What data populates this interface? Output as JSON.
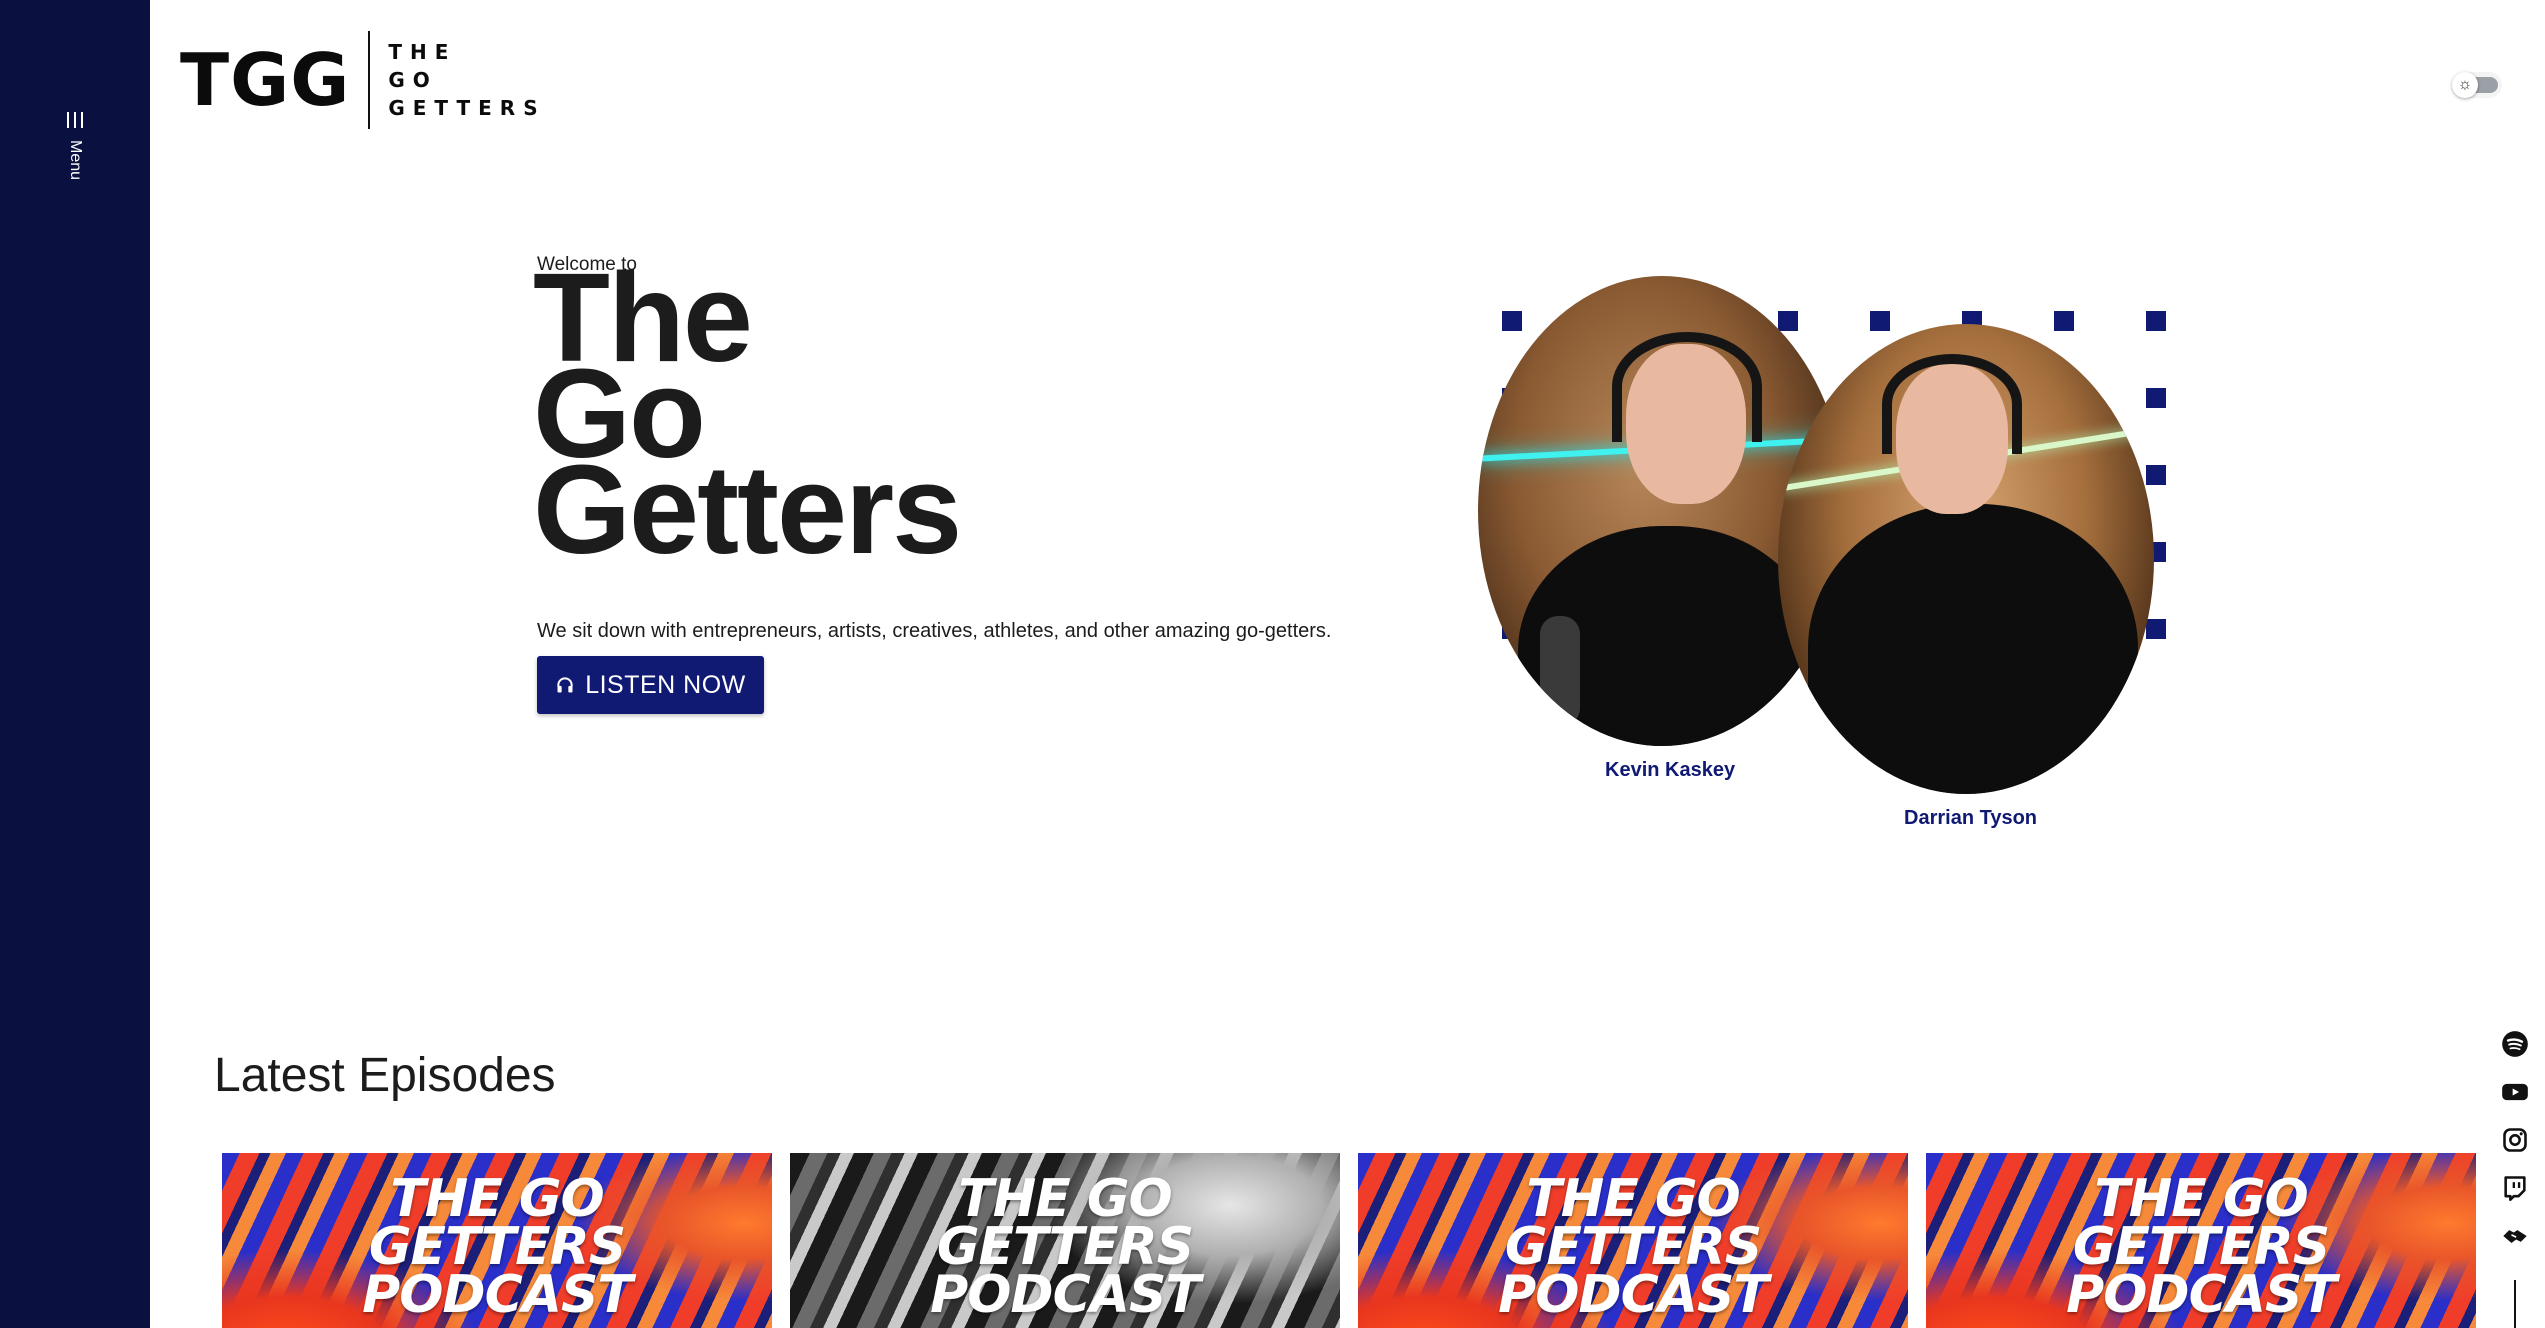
{
  "sidebar": {
    "menu_label": "Menu",
    "background": "#0a1140"
  },
  "logo": {
    "mark": "TGG",
    "words": [
      "THE",
      "GO",
      "GETTERS"
    ]
  },
  "theme_toggle": {
    "icon": "sun-icon",
    "state": "light"
  },
  "hero": {
    "intro": "Welcome to",
    "title_lines": [
      "The",
      "Go",
      "Getters"
    ],
    "description": "We sit down with entrepreneurs, artists, creatives, athletes, and other amazing go-getters.",
    "cta_label": "LISTEN NOW",
    "cta_icon": "headphones-icon",
    "accent": "#101a73"
  },
  "hosts": [
    {
      "name": "Kevin Kaskey"
    },
    {
      "name": "Darrian Tyson"
    }
  ],
  "episodes_section": {
    "title": "Latest Episodes",
    "cards": [
      {
        "art_lines": [
          "THE GO",
          "GETTERS",
          "PODCAST"
        ],
        "style": "color"
      },
      {
        "art_lines": [
          "THE GO",
          "GETTERS",
          "PODCAST"
        ],
        "style": "mono"
      },
      {
        "art_lines": [
          "THE GO",
          "GETTERS",
          "PODCAST"
        ],
        "style": "color"
      },
      {
        "art_lines": [
          "THE GO",
          "GETTERS",
          "PODCAST"
        ],
        "style": "color"
      }
    ]
  },
  "social": [
    "spotify-icon",
    "youtube-icon",
    "instagram-icon",
    "twitch-icon",
    "handshake-icon"
  ]
}
